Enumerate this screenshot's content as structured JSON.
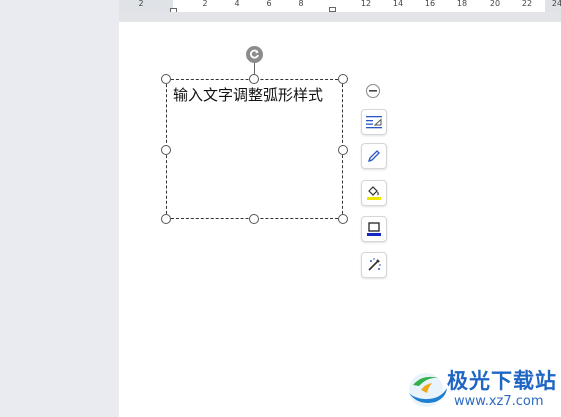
{
  "ruler": {
    "neg_label": "2",
    "labels": [
      "2",
      "4",
      "6",
      "8",
      "12",
      "14",
      "16",
      "18",
      "20",
      "22",
      "24"
    ]
  },
  "textbox": {
    "text": "输入文字调整弧形样式"
  },
  "toolbar": {
    "collapse_icon": "minus-circle-icon",
    "buttons": [
      "text-wrap-icon",
      "pen-icon",
      "fill-bucket-icon",
      "shape-outline-icon",
      "wand-icon"
    ]
  },
  "colors": {
    "fill_accent": "#f2e600",
    "outline_accent": "#1428c8",
    "tool_blue": "#2b59c3"
  },
  "watermark": {
    "title": "极光下载站",
    "url": "www.xz7.com"
  }
}
